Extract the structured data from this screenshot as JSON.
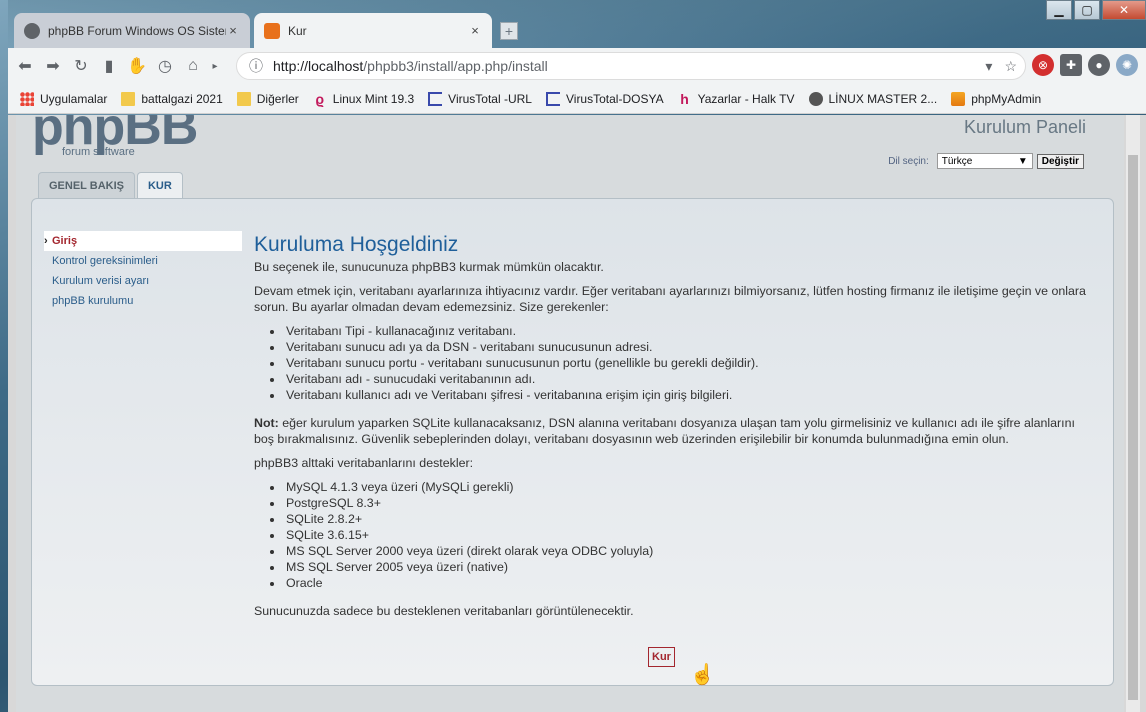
{
  "tabs": [
    {
      "title": "phpBB Forum Windows OS Sistem",
      "close": "×"
    },
    {
      "title": "Kur",
      "close": "×"
    }
  ],
  "toolbar": {
    "url_host": "http://localhost",
    "url_rest": "/phpbb3/install/app.php/install"
  },
  "bookmarks": [
    {
      "label": "Uygulamalar",
      "icon": "apps-grid-icon"
    },
    {
      "label": "battalgazi 2021",
      "icon": "folder-icon"
    },
    {
      "label": "Diğerler",
      "icon": "folder-icon"
    },
    {
      "label": "Linux Mint 19.3",
      "icon": "mint-icon"
    },
    {
      "label": "VirusTotal -URL",
      "icon": "virustotal-icon"
    },
    {
      "label": "VirusTotal-DOSYA",
      "icon": "virustotal-icon"
    },
    {
      "label": "Yazarlar - Halk TV",
      "icon": "halktv-icon"
    },
    {
      "label": "LİNUX MASTER 2...",
      "icon": "globe-icon"
    },
    {
      "label": "phpMyAdmin",
      "icon": "pma-icon"
    }
  ],
  "page": {
    "logo_big": "phpBB",
    "logo_small": "forum  software",
    "panel_title": "Kurulum Paneli",
    "lang_label": "Dil seçin:",
    "lang_value": "Türkçe",
    "lang_button": "Değiştir",
    "tabs": [
      "GENEL BAKIŞ",
      "KUR"
    ],
    "menu": [
      "Giriş",
      "Kontrol gereksinimleri",
      "Kurulum verisi ayarı",
      "phpBB kurulumu"
    ],
    "heading": "Kuruluma Hoşgeldiniz",
    "intro": "Bu seçenek ile, sunucunuza phpBB3 kurmak mümkün olacaktır.",
    "para1": "Devam etmek için, veritabanı ayarlarınıza ihtiyacınız vardır. Eğer veritabanı ayarlarınızı bilmiyorsanız, lütfen hosting firmanız ile iletişime geçin ve onlara sorun. Bu ayarlar olmadan devam edemezsiniz. Size gerekenler:",
    "needs": [
      "Veritabanı Tipi - kullanacağınız veritabanı.",
      "Veritabanı sunucu adı ya da DSN - veritabanı sunucusunun adresi.",
      "Veritabanı sunucu portu - veritabanı sunucusunun portu (genellikle bu gerekli değildir).",
      "Veritabanı adı - sunucudaki veritabanının adı.",
      "Veritabanı kullanıcı adı ve Veritabanı şifresi - veritabanına erişim için giriş bilgileri."
    ],
    "note_label": "Not:",
    "note_text": " eğer kurulum yaparken SQLite kullanacaksanız, DSN alanına veritabanı dosyanıza ulaşan tam yolu girmelisiniz ve kullanıcı adı ile şifre alanlarını boş bırakmalısınız. Güvenlik sebeplerinden dolayı, veritabanı dosyasının web üzerinden erişilebilir bir konumda bulunmadığına emin olun.",
    "supports": "phpBB3 alttaki veritabanlarını destekler:",
    "dbs": [
      "MySQL 4.1.3 veya üzeri (MySQLi gerekli)",
      "PostgreSQL 8.3+",
      "SQLite 2.8.2+",
      "SQLite 3.6.15+",
      "MS SQL Server 2000 veya üzeri (direkt olarak veya ODBC yoluyla)",
      "MS SQL Server 2005 veya üzeri (native)",
      "Oracle"
    ],
    "footer_note": "Sunucunuzda sadece bu desteklenen veritabanları görüntülenecektir.",
    "install_button": "Kur"
  }
}
